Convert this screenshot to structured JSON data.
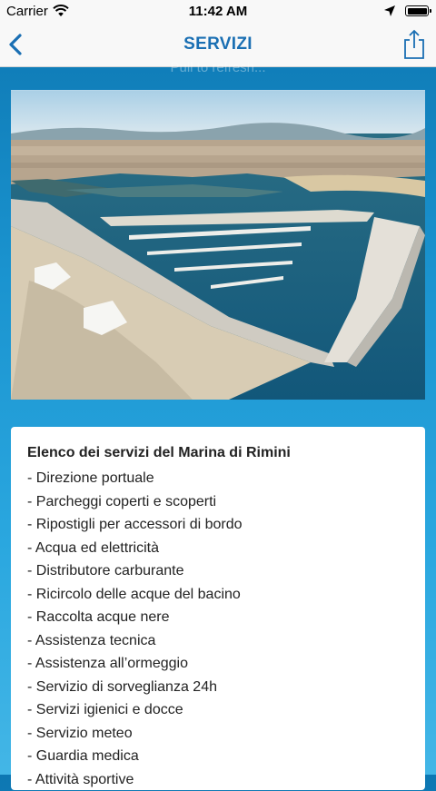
{
  "status_bar": {
    "carrier": "Carrier",
    "time": "11:42 AM"
  },
  "nav": {
    "title": "SERVIZI",
    "back_icon": "chevron-left-icon",
    "share_icon": "share-icon"
  },
  "pull_to_refresh": "Pull to refresh...",
  "colors": {
    "nav_title": "#1a6fb3",
    "background_top": "#0d77b2",
    "background_bottom": "#43b6e6"
  },
  "services": {
    "heading": "Elenco dei servizi del Marina di Rimini",
    "items": [
      "- Direzione portuale",
      "- Parcheggi coperti e scoperti",
      "- Ripostigli per accessori di bordo",
      "- Acqua ed elettricità",
      "- Distributore carburante",
      "- Ricircolo delle acque del bacino",
      "- Raccolta acque nere",
      "- Assistenza tecnica",
      "- Assistenza all’ormeggio",
      "- Servizio di sorveglianza 24h",
      "- Servizi igienici e docce",
      "- Servizio meteo",
      "- Guardia medica",
      "- Attività sportive"
    ]
  }
}
